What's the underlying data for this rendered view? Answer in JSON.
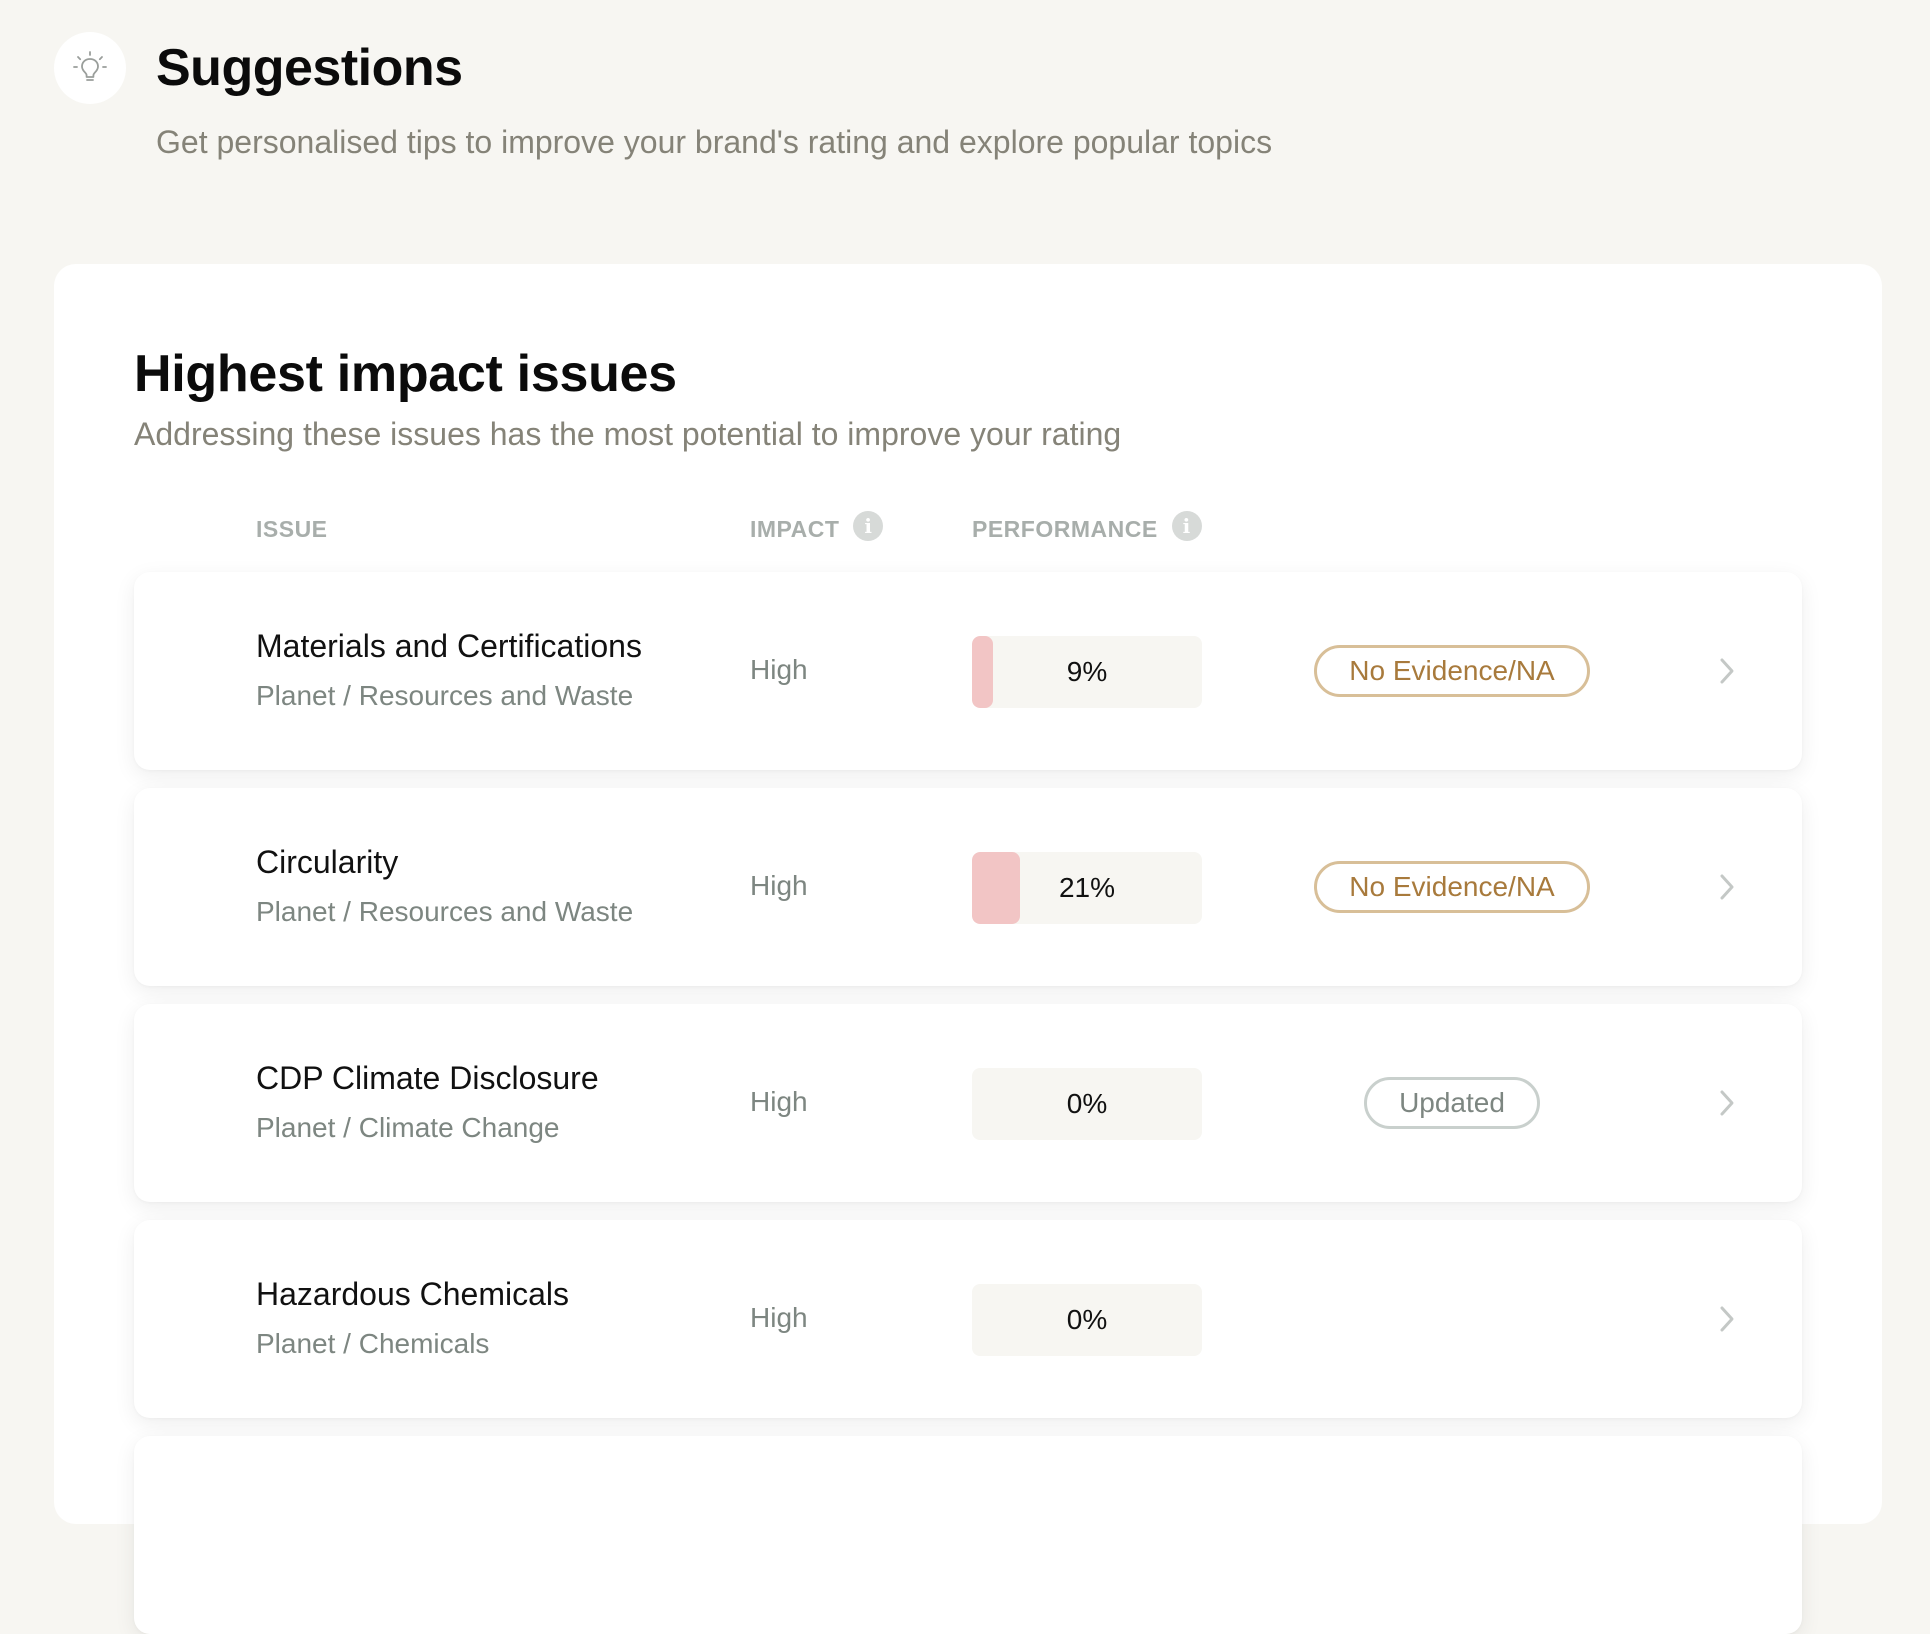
{
  "header": {
    "title": "Suggestions",
    "subtitle": "Get personalised tips to improve your brand's rating and explore popular topics",
    "icon": "lightbulb-icon"
  },
  "section": {
    "title": "Highest impact issues",
    "subtitle": "Addressing these issues has the most potential to improve your rating"
  },
  "columns": {
    "issue": "ISSUE",
    "impact": "IMPACT",
    "performance": "PERFORMANCE",
    "info_icon_glyph": "i"
  },
  "colors": {
    "background": "#f7f6f2",
    "perf_fill": "#f2c5c5",
    "badge_evidence": "#a87a3c",
    "badge_updated": "#7d8681"
  },
  "rows": [
    {
      "name": "Materials and Certifications",
      "category": "Planet / Resources and Waste",
      "impact": "High",
      "performance": 9,
      "performance_label": "9%",
      "badge": "No Evidence/NA"
    },
    {
      "name": "Circularity",
      "category": "Planet / Resources and Waste",
      "impact": "High",
      "performance": 21,
      "performance_label": "21%",
      "badge": "No Evidence/NA"
    },
    {
      "name": "CDP Climate Disclosure",
      "category": "Planet / Climate Change",
      "impact": "High",
      "performance": 0,
      "performance_label": "0%",
      "badge": "Updated"
    },
    {
      "name": "Hazardous Chemicals",
      "category": "Planet / Chemicals",
      "impact": "High",
      "performance": 0,
      "performance_label": "0%",
      "badge": ""
    }
  ]
}
